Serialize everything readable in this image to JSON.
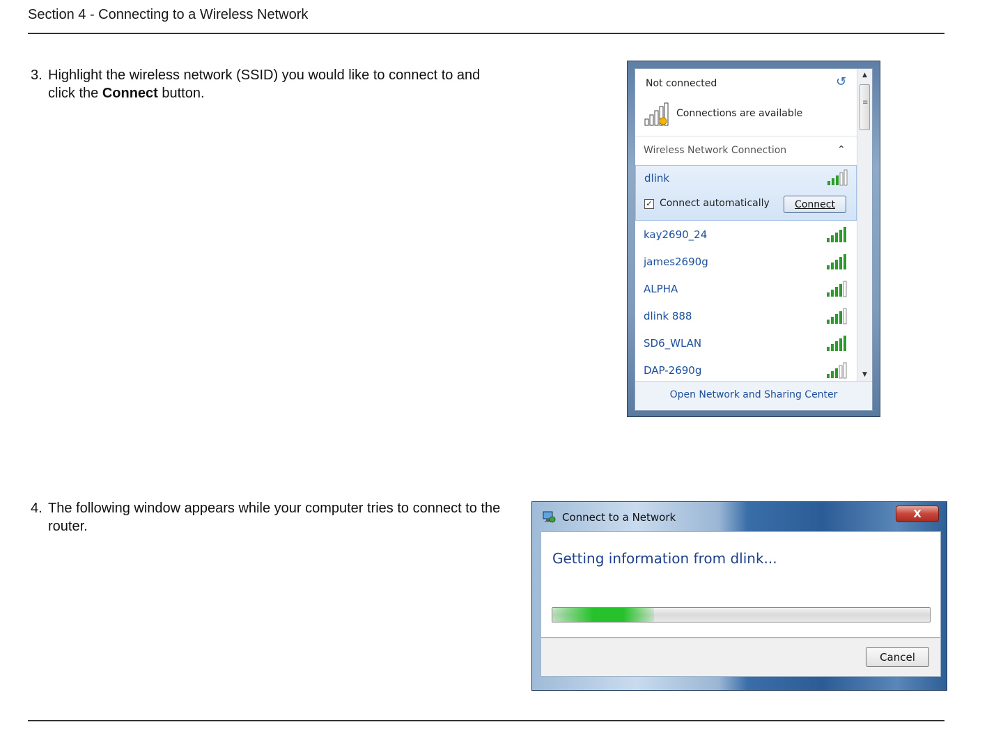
{
  "page": {
    "section_header": "Section 4 - Connecting to a Wireless Network"
  },
  "steps": [
    {
      "number": "3.",
      "text_before": "Highlight the wireless network (SSID) you would like to connect to and click the ",
      "bold": "Connect",
      "text_after": " button."
    },
    {
      "number": "4.",
      "text": "The following window appears while your computer tries to connect to the router."
    }
  ],
  "wifi_panel": {
    "status": "Not connected",
    "available_text": "Connections are available",
    "group_label": "Wireless Network Connection",
    "selected_network": {
      "name": "dlink",
      "connect_auto_label": "Connect automatically",
      "connect_auto_checked": "✓",
      "connect_button": "Connect"
    },
    "networks": [
      {
        "name": "kay2690_24"
      },
      {
        "name": "james2690g"
      },
      {
        "name": "ALPHA"
      },
      {
        "name": "dlink 888"
      },
      {
        "name": "SD6_WLAN"
      },
      {
        "name": "DAP-2690g"
      }
    ],
    "footer_link": "Open Network and Sharing Center",
    "icons": {
      "refresh": "refresh-icon",
      "collapse": "chevron-up-icon",
      "signal": "signal-bars-icon"
    },
    "signal_color": "#2e9a2e"
  },
  "dialog": {
    "title": "Connect to a Network",
    "close_label": "X",
    "message": "Getting information from dlink...",
    "progress": 0.27,
    "cancel_button": "Cancel"
  }
}
